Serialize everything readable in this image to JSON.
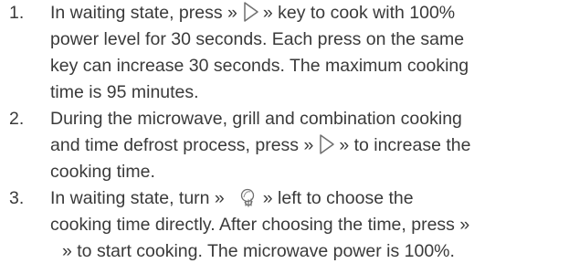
{
  "instructions": [
    {
      "number": "1.",
      "lines": [
        [
          "In waiting state, press »",
          "play-icon",
          "» key to cook with 100%"
        ],
        [
          "power level for 30 seconds. Each press on the same"
        ],
        [
          "key can increase 30 seconds. The maximum cooking"
        ],
        [
          "time is 95 minutes."
        ]
      ]
    },
    {
      "number": "2.",
      "lines": [
        [
          "During the microwave, grill and combination cooking"
        ],
        [
          "and time defrost process, press »",
          "play-icon",
          "» to increase the"
        ],
        [
          "cooking time."
        ]
      ]
    },
    {
      "number": "3.",
      "lines": [
        [
          "In waiting state, turn »",
          "knob-icon",
          "» left to choose the"
        ],
        [
          "cooking time directly. After choosing the time, press »"
        ],
        [
          "» to start cooking. The microwave power is 100%."
        ]
      ]
    }
  ],
  "colors": {
    "text": "#3a3a3a",
    "icon_stroke": "#6f6f6f"
  }
}
